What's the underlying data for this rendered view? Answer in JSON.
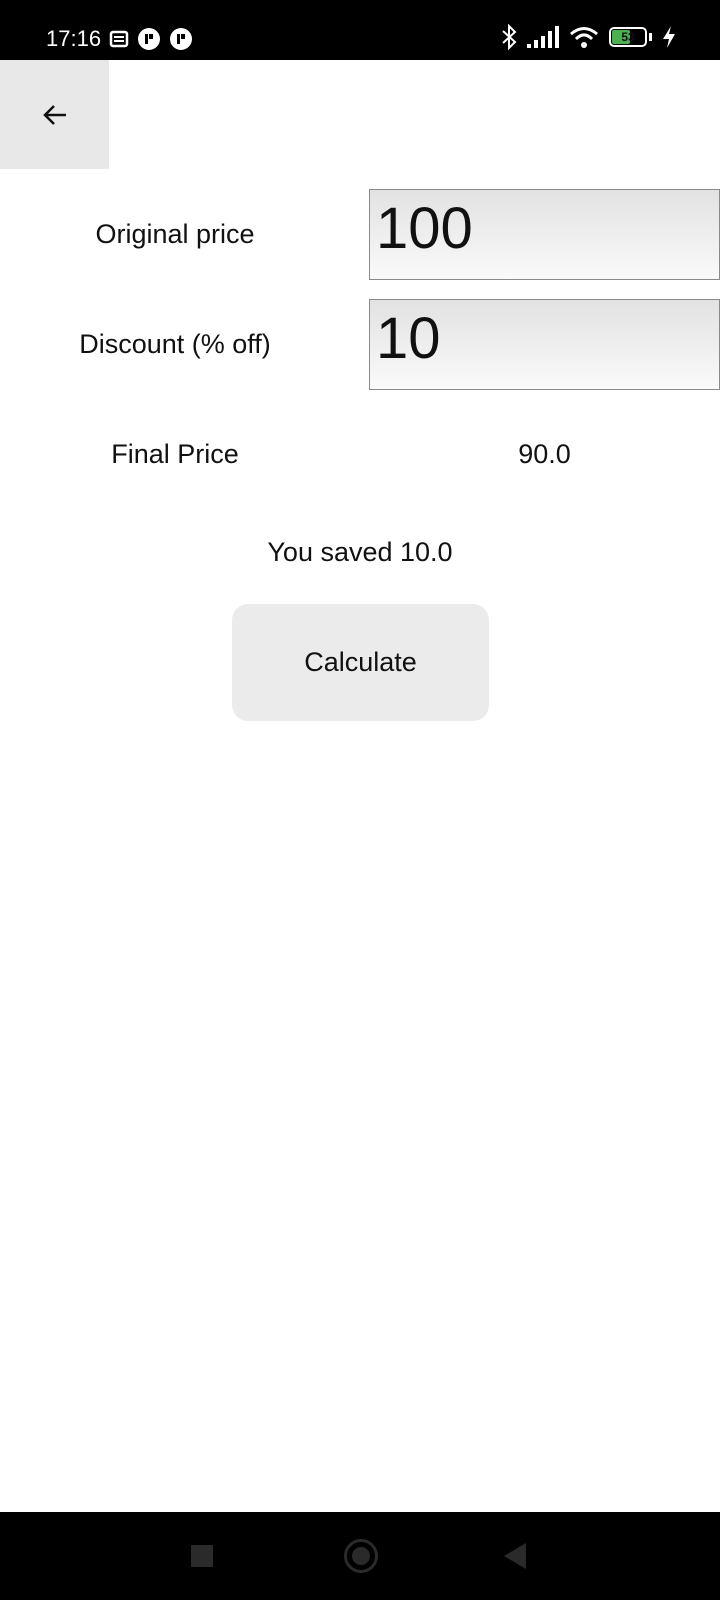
{
  "status_bar": {
    "time": "17:16",
    "battery_level": "53",
    "icons": [
      "notes-icon",
      "app-notification-icon",
      "app-notification-icon",
      "bluetooth-icon",
      "signal-icon",
      "wifi-icon",
      "battery-icon",
      "charging-icon"
    ]
  },
  "toolbar": {
    "back_icon": "arrow-left-icon"
  },
  "form": {
    "original_price_label": "Original price",
    "original_price_value": "100",
    "discount_label": "Discount (% off)",
    "discount_value": "10",
    "final_price_label": "Final Price",
    "final_price_value": "90.0",
    "saved_text": "You saved 10.0",
    "calculate_label": "Calculate"
  },
  "nav_bar": {
    "icons": [
      "recents-icon",
      "home-icon",
      "back-icon"
    ]
  }
}
